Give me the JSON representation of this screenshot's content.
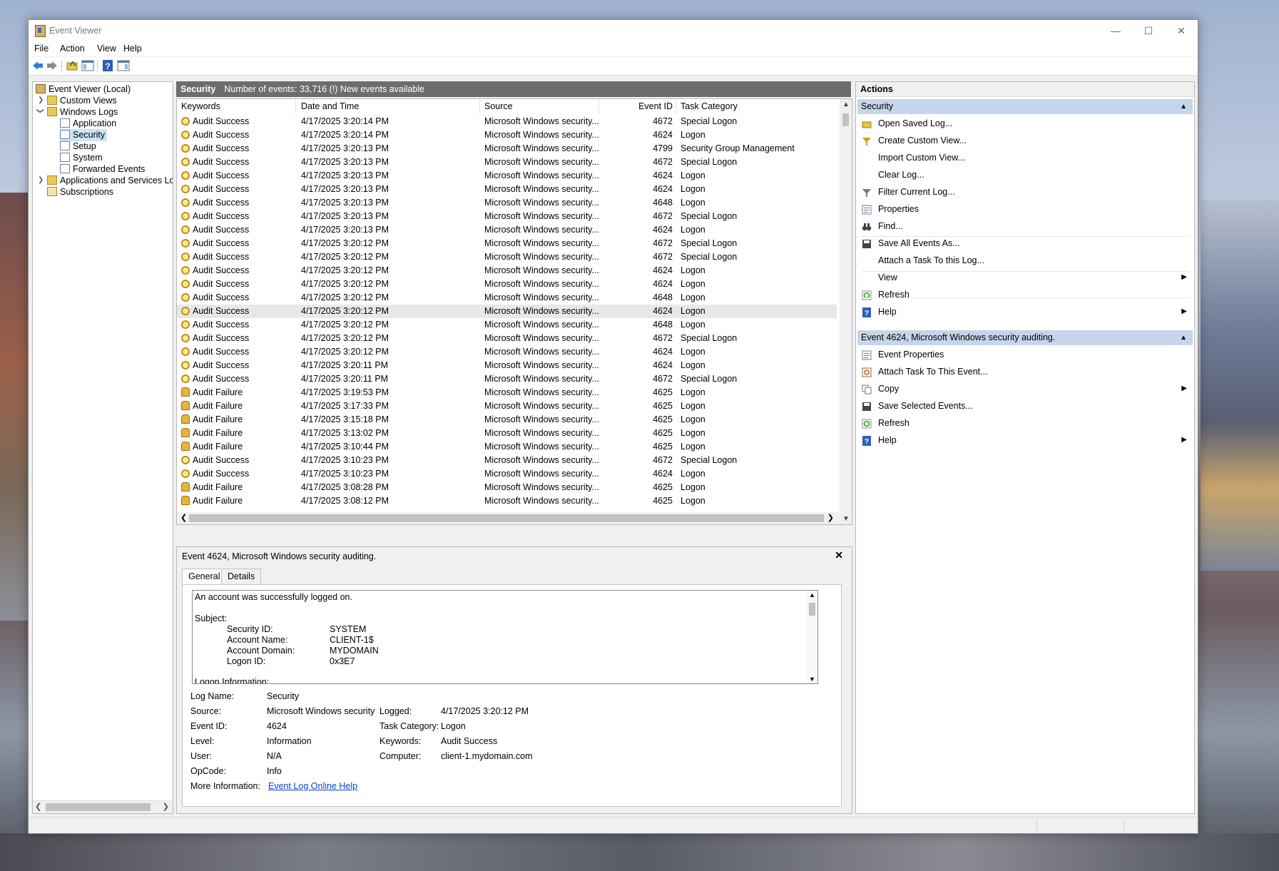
{
  "window": {
    "title": "Event Viewer"
  },
  "menu": [
    "File",
    "Action",
    "View",
    "Help"
  ],
  "tree": {
    "root": "Event Viewer (Local)",
    "custom_views": "Custom Views",
    "windows_logs": "Windows Logs",
    "logs": [
      "Application",
      "Security",
      "Setup",
      "System",
      "Forwarded Events"
    ],
    "apps_services": "Applications and Services Lo",
    "subscriptions": "Subscriptions"
  },
  "list_header": {
    "log_name": "Security",
    "summary": "Number of events: 33,716 (!) New events available"
  },
  "columns": [
    "Keywords",
    "Date and Time",
    "Source",
    "Event ID",
    "Task Category"
  ],
  "events": [
    {
      "kw": "Audit Success",
      "dt": "4/17/2025 3:20:14 PM",
      "src": "Microsoft Windows security...",
      "id": "4672",
      "cat": "Special Logon"
    },
    {
      "kw": "Audit Success",
      "dt": "4/17/2025 3:20:14 PM",
      "src": "Microsoft Windows security...",
      "id": "4624",
      "cat": "Logon"
    },
    {
      "kw": "Audit Success",
      "dt": "4/17/2025 3:20:13 PM",
      "src": "Microsoft Windows security...",
      "id": "4799",
      "cat": "Security Group Management"
    },
    {
      "kw": "Audit Success",
      "dt": "4/17/2025 3:20:13 PM",
      "src": "Microsoft Windows security...",
      "id": "4672",
      "cat": "Special Logon"
    },
    {
      "kw": "Audit Success",
      "dt": "4/17/2025 3:20:13 PM",
      "src": "Microsoft Windows security...",
      "id": "4624",
      "cat": "Logon"
    },
    {
      "kw": "Audit Success",
      "dt": "4/17/2025 3:20:13 PM",
      "src": "Microsoft Windows security...",
      "id": "4624",
      "cat": "Logon"
    },
    {
      "kw": "Audit Success",
      "dt": "4/17/2025 3:20:13 PM",
      "src": "Microsoft Windows security...",
      "id": "4648",
      "cat": "Logon"
    },
    {
      "kw": "Audit Success",
      "dt": "4/17/2025 3:20:13 PM",
      "src": "Microsoft Windows security...",
      "id": "4672",
      "cat": "Special Logon"
    },
    {
      "kw": "Audit Success",
      "dt": "4/17/2025 3:20:13 PM",
      "src": "Microsoft Windows security...",
      "id": "4624",
      "cat": "Logon"
    },
    {
      "kw": "Audit Success",
      "dt": "4/17/2025 3:20:12 PM",
      "src": "Microsoft Windows security...",
      "id": "4672",
      "cat": "Special Logon"
    },
    {
      "kw": "Audit Success",
      "dt": "4/17/2025 3:20:12 PM",
      "src": "Microsoft Windows security...",
      "id": "4672",
      "cat": "Special Logon"
    },
    {
      "kw": "Audit Success",
      "dt": "4/17/2025 3:20:12 PM",
      "src": "Microsoft Windows security...",
      "id": "4624",
      "cat": "Logon"
    },
    {
      "kw": "Audit Success",
      "dt": "4/17/2025 3:20:12 PM",
      "src": "Microsoft Windows security...",
      "id": "4624",
      "cat": "Logon"
    },
    {
      "kw": "Audit Success",
      "dt": "4/17/2025 3:20:12 PM",
      "src": "Microsoft Windows security...",
      "id": "4648",
      "cat": "Logon"
    },
    {
      "kw": "Audit Success",
      "dt": "4/17/2025 3:20:12 PM",
      "src": "Microsoft Windows security...",
      "id": "4624",
      "cat": "Logon",
      "selected": true
    },
    {
      "kw": "Audit Success",
      "dt": "4/17/2025 3:20:12 PM",
      "src": "Microsoft Windows security...",
      "id": "4648",
      "cat": "Logon"
    },
    {
      "kw": "Audit Success",
      "dt": "4/17/2025 3:20:12 PM",
      "src": "Microsoft Windows security...",
      "id": "4672",
      "cat": "Special Logon"
    },
    {
      "kw": "Audit Success",
      "dt": "4/17/2025 3:20:12 PM",
      "src": "Microsoft Windows security...",
      "id": "4624",
      "cat": "Logon"
    },
    {
      "kw": "Audit Success",
      "dt": "4/17/2025 3:20:11 PM",
      "src": "Microsoft Windows security...",
      "id": "4624",
      "cat": "Logon"
    },
    {
      "kw": "Audit Success",
      "dt": "4/17/2025 3:20:11 PM",
      "src": "Microsoft Windows security...",
      "id": "4672",
      "cat": "Special Logon"
    },
    {
      "kw": "Audit Failure",
      "dt": "4/17/2025 3:19:53 PM",
      "src": "Microsoft Windows security...",
      "id": "4625",
      "cat": "Logon"
    },
    {
      "kw": "Audit Failure",
      "dt": "4/17/2025 3:17:33 PM",
      "src": "Microsoft Windows security...",
      "id": "4625",
      "cat": "Logon"
    },
    {
      "kw": "Audit Failure",
      "dt": "4/17/2025 3:15:18 PM",
      "src": "Microsoft Windows security...",
      "id": "4625",
      "cat": "Logon"
    },
    {
      "kw": "Audit Failure",
      "dt": "4/17/2025 3:13:02 PM",
      "src": "Microsoft Windows security...",
      "id": "4625",
      "cat": "Logon"
    },
    {
      "kw": "Audit Failure",
      "dt": "4/17/2025 3:10:44 PM",
      "src": "Microsoft Windows security...",
      "id": "4625",
      "cat": "Logon"
    },
    {
      "kw": "Audit Success",
      "dt": "4/17/2025 3:10:23 PM",
      "src": "Microsoft Windows security...",
      "id": "4672",
      "cat": "Special Logon"
    },
    {
      "kw": "Audit Success",
      "dt": "4/17/2025 3:10:23 PM",
      "src": "Microsoft Windows security...",
      "id": "4624",
      "cat": "Logon"
    },
    {
      "kw": "Audit Failure",
      "dt": "4/17/2025 3:08:28 PM",
      "src": "Microsoft Windows security...",
      "id": "4625",
      "cat": "Logon"
    },
    {
      "kw": "Audit Failure",
      "dt": "4/17/2025 3:08:12 PM",
      "src": "Microsoft Windows security...",
      "id": "4625",
      "cat": "Logon"
    }
  ],
  "detail": {
    "title": "Event 4624, Microsoft Windows security auditing.",
    "tabs": [
      "General",
      "Details"
    ],
    "description": {
      "line1": "An account was successfully logged on.",
      "subject": "Subject:",
      "security_id_label": "Security ID:",
      "security_id": "SYSTEM",
      "account_name_label": "Account Name:",
      "account_name": "CLIENT-1$",
      "account_domain_label": "Account Domain:",
      "account_domain": "MYDOMAIN",
      "logon_id_label": "Logon ID:",
      "logon_id": "0x3E7",
      "cut_line": "Logon Information:"
    },
    "props": {
      "log_name_label": "Log Name:",
      "log_name": "Security",
      "source_label": "Source:",
      "source": "Microsoft Windows security",
      "logged_label": "Logged:",
      "logged": "4/17/2025 3:20:12 PM",
      "event_id_label": "Event ID:",
      "event_id": "4624",
      "task_category_label": "Task Category:",
      "task_category": "Logon",
      "level_label": "Level:",
      "level": "Information",
      "keywords_label": "Keywords:",
      "keywords": "Audit Success",
      "user_label": "User:",
      "user": "N/A",
      "computer_label": "Computer:",
      "computer": "client-1.mydomain.com",
      "opcode_label": "OpCode:",
      "opcode": "Info",
      "more_info_label": "More Information:",
      "more_info_link": "Event Log Online Help"
    }
  },
  "actions": {
    "title": "Actions",
    "section1": "Security",
    "items1": [
      {
        "label": "Open Saved Log...",
        "icon": "open-folder-icon"
      },
      {
        "label": "Create Custom View...",
        "icon": "filter-create-icon"
      },
      {
        "label": "Import Custom View...",
        "icon": ""
      },
      {
        "label": "Clear Log...",
        "icon": ""
      },
      {
        "label": "Filter Current Log...",
        "icon": "filter-icon"
      },
      {
        "label": "Properties",
        "icon": "properties-icon"
      },
      {
        "label": "Find...",
        "icon": "binoculars-icon"
      },
      {
        "label": "Save All Events As...",
        "icon": "save-icon"
      },
      {
        "label": "Attach a Task To this Log...",
        "icon": ""
      },
      {
        "label": "View",
        "icon": "",
        "submenu": true
      },
      {
        "label": "Refresh",
        "icon": "refresh-icon"
      },
      {
        "label": "Help",
        "icon": "help-icon",
        "submenu": true
      }
    ],
    "section2": "Event 4624, Microsoft Windows security auditing.",
    "items2": [
      {
        "label": "Event Properties",
        "icon": "properties-icon"
      },
      {
        "label": "Attach Task To This Event...",
        "icon": "task-icon"
      },
      {
        "label": "Copy",
        "icon": "copy-icon",
        "submenu": true
      },
      {
        "label": "Save Selected Events...",
        "icon": "save-icon"
      },
      {
        "label": "Refresh",
        "icon": "refresh-icon"
      },
      {
        "label": "Help",
        "icon": "help-icon",
        "submenu": true
      }
    ]
  }
}
